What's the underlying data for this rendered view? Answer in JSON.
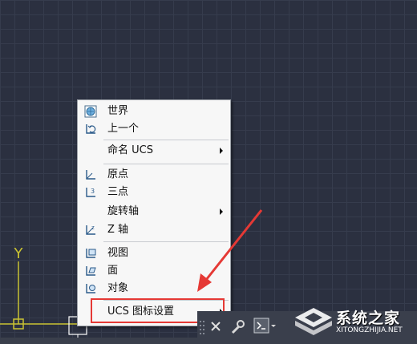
{
  "ucs_icon": {
    "axis_label": "Y"
  },
  "menu": {
    "items": [
      {
        "label": "世界",
        "icon": "world-ucs-icon",
        "submenu": false
      },
      {
        "label": "上一个",
        "icon": "previous-ucs-icon",
        "submenu": false
      },
      {
        "label": "命名 UCS",
        "icon": "",
        "submenu": true
      },
      {
        "label": "原点",
        "icon": "origin-ucs-icon",
        "submenu": false
      },
      {
        "label": "三点",
        "icon": "three-point-ucs-icon",
        "submenu": false
      },
      {
        "label": "旋转轴",
        "icon": "",
        "submenu": true
      },
      {
        "label": "Z 轴",
        "icon": "z-axis-ucs-icon",
        "submenu": false
      },
      {
        "label": "视图",
        "icon": "view-ucs-icon",
        "submenu": false
      },
      {
        "label": "面",
        "icon": "face-ucs-icon",
        "submenu": false
      },
      {
        "label": "对象",
        "icon": "object-ucs-icon",
        "submenu": false
      },
      {
        "label": "UCS 图标设置",
        "icon": "",
        "submenu": true
      }
    ]
  },
  "annotation": {
    "color": "#e53935"
  },
  "watermark": {
    "title": "系统之家",
    "url": "XITONGZHIJIA.NET"
  },
  "colors": {
    "canvas": "#2b3040",
    "grid": "#363c4d",
    "ucs_axis": "#c9c232",
    "menu_bg": "#f7f7f7"
  }
}
